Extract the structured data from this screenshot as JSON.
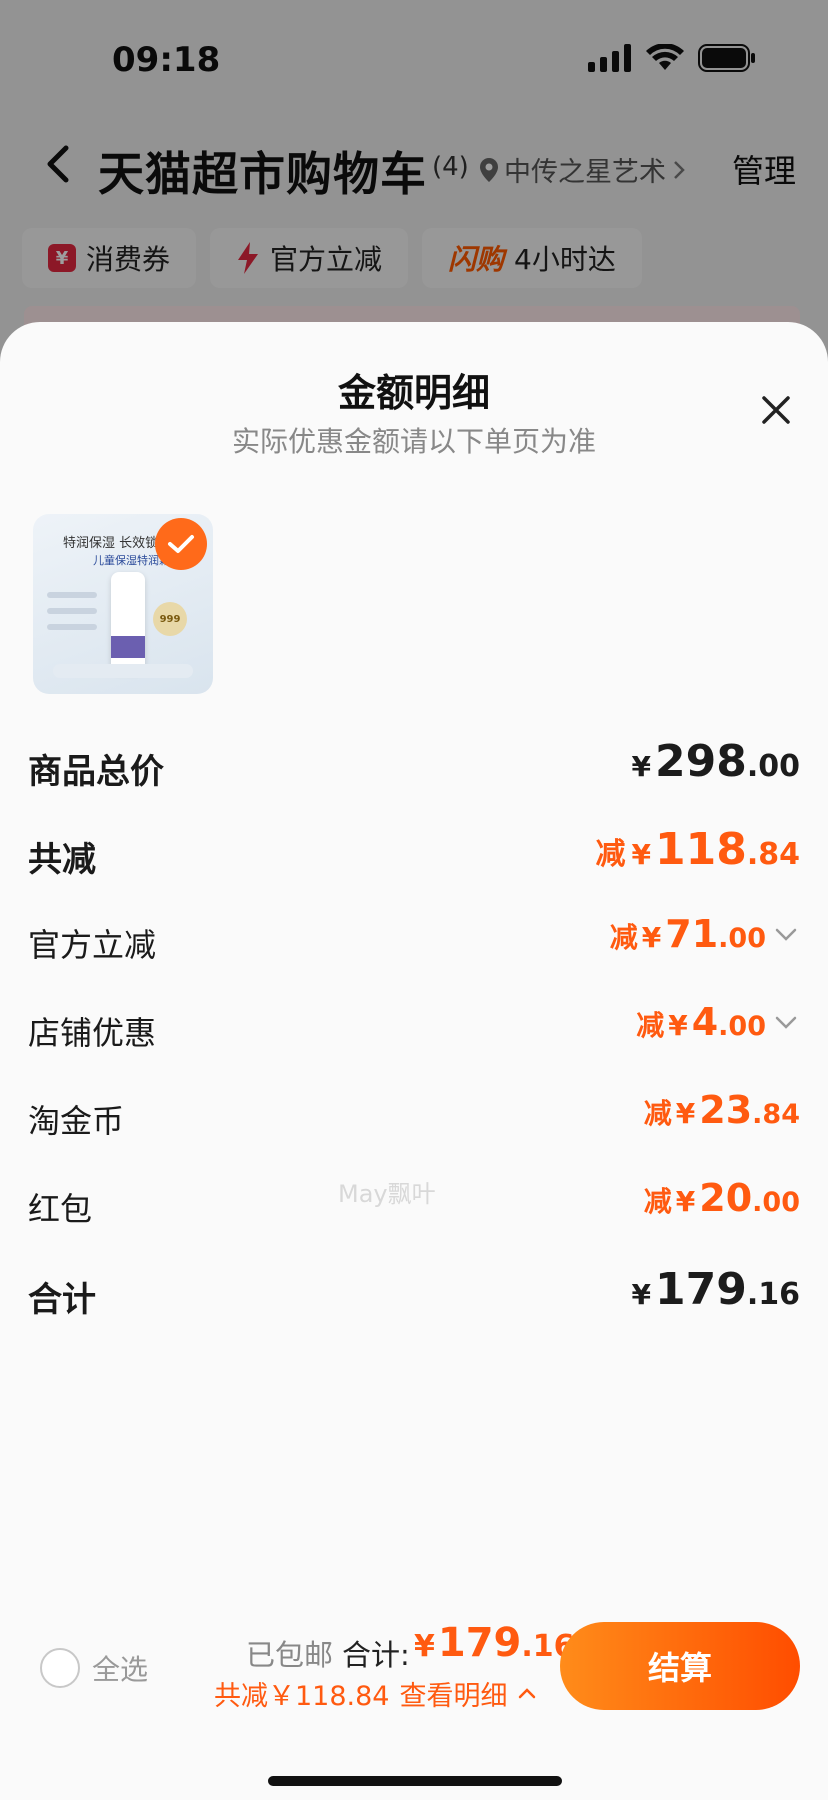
{
  "status_bar": {
    "time": "09:18"
  },
  "cart_header": {
    "title": "天猫超市购物车",
    "count": "(4)",
    "location": "中传之星艺术",
    "manage": "管理"
  },
  "chips": [
    {
      "icon": "coupon-icon",
      "label": "消费券"
    },
    {
      "icon": "lightning-icon",
      "label": "官方立减"
    },
    {
      "brand": "闪购",
      "label": "4小时达"
    }
  ],
  "sheet": {
    "title": "金额明细",
    "subtitle": "实际优惠金额请以下单页为准",
    "product_image": {
      "headline": "特润保湿 长效锁",
      "subline": "儿童保湿特润霜",
      "badge": "999"
    },
    "rows": [
      {
        "label": "商品总价",
        "prefix": "",
        "yen": "¥",
        "int": "298",
        "dec": ".00",
        "style": "total"
      },
      {
        "label": "共减",
        "prefix": "减",
        "yen": "¥",
        "int": "118",
        "dec": ".84",
        "style": "discount-total"
      },
      {
        "label": "官方立减",
        "prefix": "减",
        "yen": "¥",
        "int": "71",
        "dec": ".00",
        "style": "discount",
        "expand": true
      },
      {
        "label": "店铺优惠",
        "prefix": "减",
        "yen": "¥",
        "int": "4",
        "dec": ".00",
        "style": "discount",
        "expand": true
      },
      {
        "label": "淘金币",
        "prefix": "减",
        "yen": "¥",
        "int": "23",
        "dec": ".84",
        "style": "discount"
      },
      {
        "label": "红包",
        "prefix": "减",
        "yen": "¥",
        "int": "20",
        "dec": ".00",
        "style": "discount"
      },
      {
        "label": "合计",
        "prefix": "",
        "yen": "¥",
        "int": "179",
        "dec": ".16",
        "style": "total"
      }
    ],
    "watermark": "May飘叶"
  },
  "bottom_bar": {
    "select_all": "全选",
    "shipping": "已包邮",
    "total_label": "合计:",
    "total_yen": "¥",
    "total_int": "179",
    "total_dec": ".16",
    "saved": "共减￥118.84",
    "details": "查看明细",
    "checkout": "结算"
  },
  "colors": {
    "accent": "#ff5a10",
    "checkout_start": "#ff8c1a",
    "checkout_end": "#ff4d00"
  }
}
